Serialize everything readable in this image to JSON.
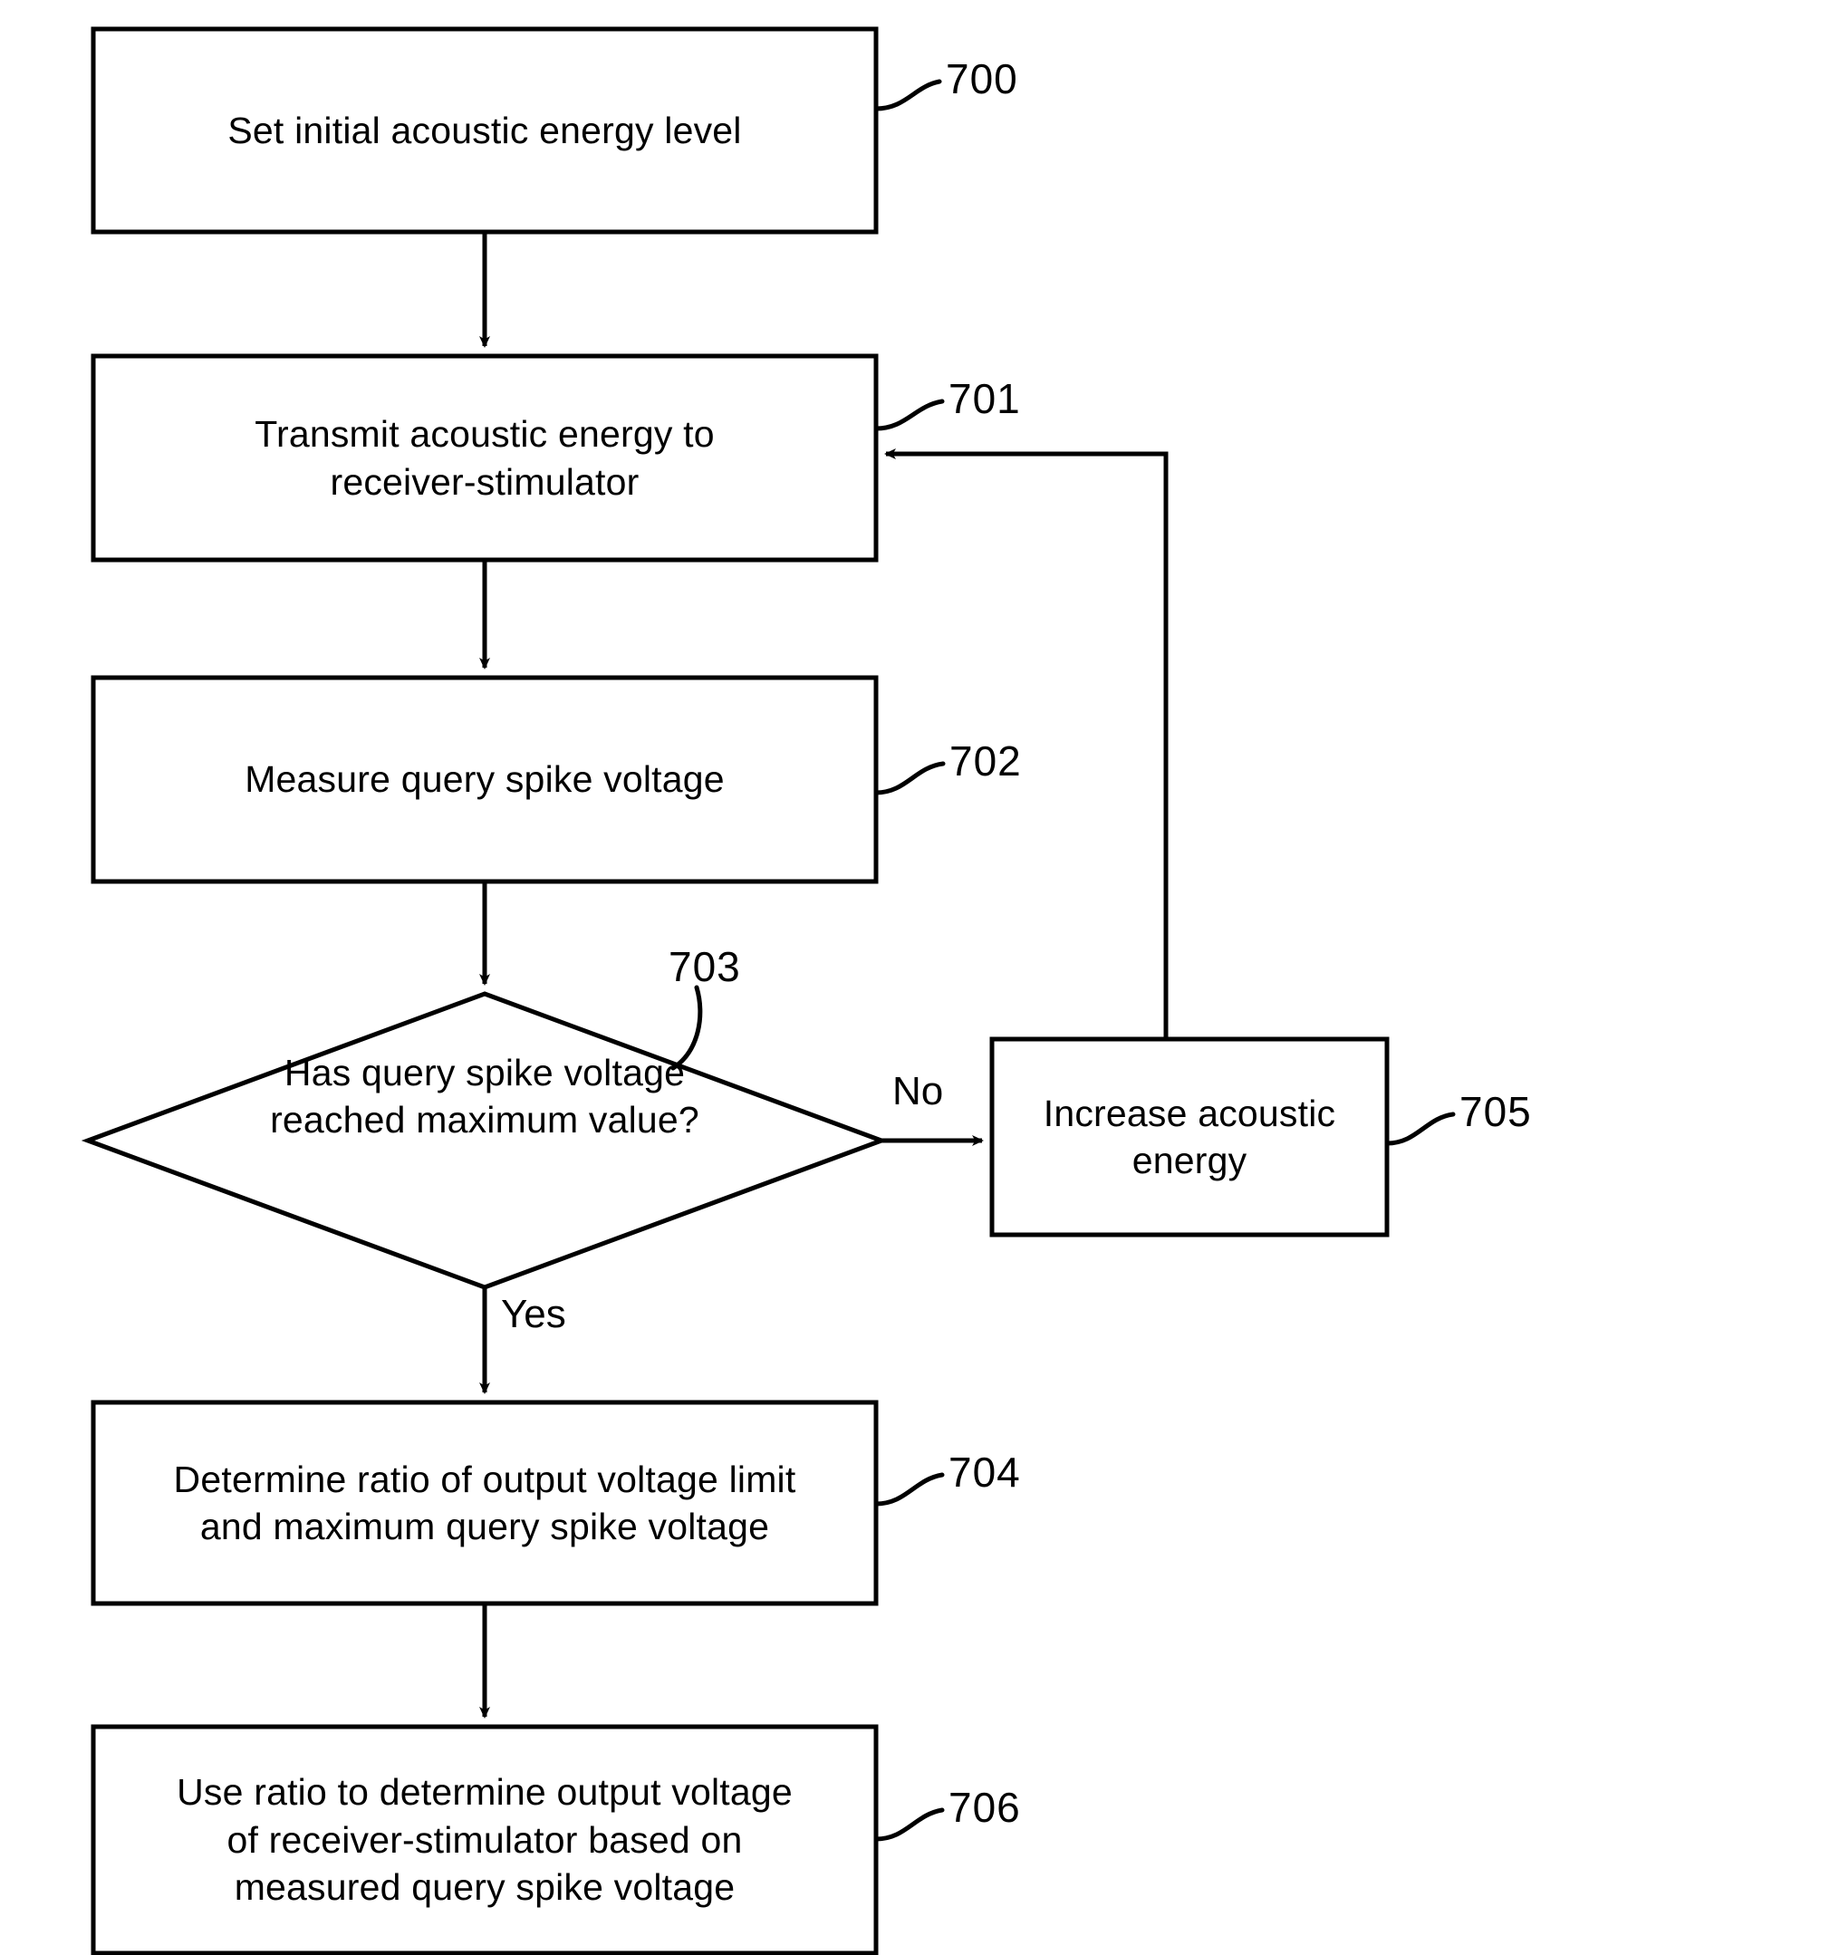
{
  "figure": {
    "type": "flowchart",
    "orientation": "vertical-with-feedback-loop",
    "background_color": "#ffffff",
    "stroke_color": "#000000"
  },
  "nodes": [
    {
      "id": "700",
      "shape": "process",
      "ref": "700",
      "text": "Set initial acoustic energy level"
    },
    {
      "id": "701",
      "shape": "process",
      "ref": "701",
      "text": "Transmit acoustic energy to\nreceiver-stimulator"
    },
    {
      "id": "702",
      "shape": "process",
      "ref": "702",
      "text": "Measure query spike voltage"
    },
    {
      "id": "703",
      "shape": "decision",
      "ref": "703",
      "text": "Has query spike voltage\nreached maximum value?"
    },
    {
      "id": "705",
      "shape": "process",
      "ref": "705",
      "text": "Increase acoustic energy"
    },
    {
      "id": "704",
      "shape": "process",
      "ref": "704",
      "text": "Determine ratio of output voltage limit\nand maximum query spike voltage"
    },
    {
      "id": "706",
      "shape": "process",
      "ref": "706",
      "text": "Use ratio to determine output voltage\nof receiver-stimulator based on\nmeasured query spike voltage"
    }
  ],
  "edges": [
    {
      "from": "700",
      "to": "701",
      "label": ""
    },
    {
      "from": "701",
      "to": "702",
      "label": ""
    },
    {
      "from": "702",
      "to": "703",
      "label": ""
    },
    {
      "from": "703",
      "to": "705",
      "label": "No"
    },
    {
      "from": "703",
      "to": "704",
      "label": "Yes"
    },
    {
      "from": "705",
      "to": "701",
      "label": ""
    },
    {
      "from": "704",
      "to": "706",
      "label": ""
    }
  ],
  "edge_labels": {
    "no": "No",
    "yes": "Yes"
  },
  "ref_labels": {
    "n700": "700",
    "n701": "701",
    "n702": "702",
    "n703": "703",
    "n704": "704",
    "n705": "705",
    "n706": "706"
  }
}
